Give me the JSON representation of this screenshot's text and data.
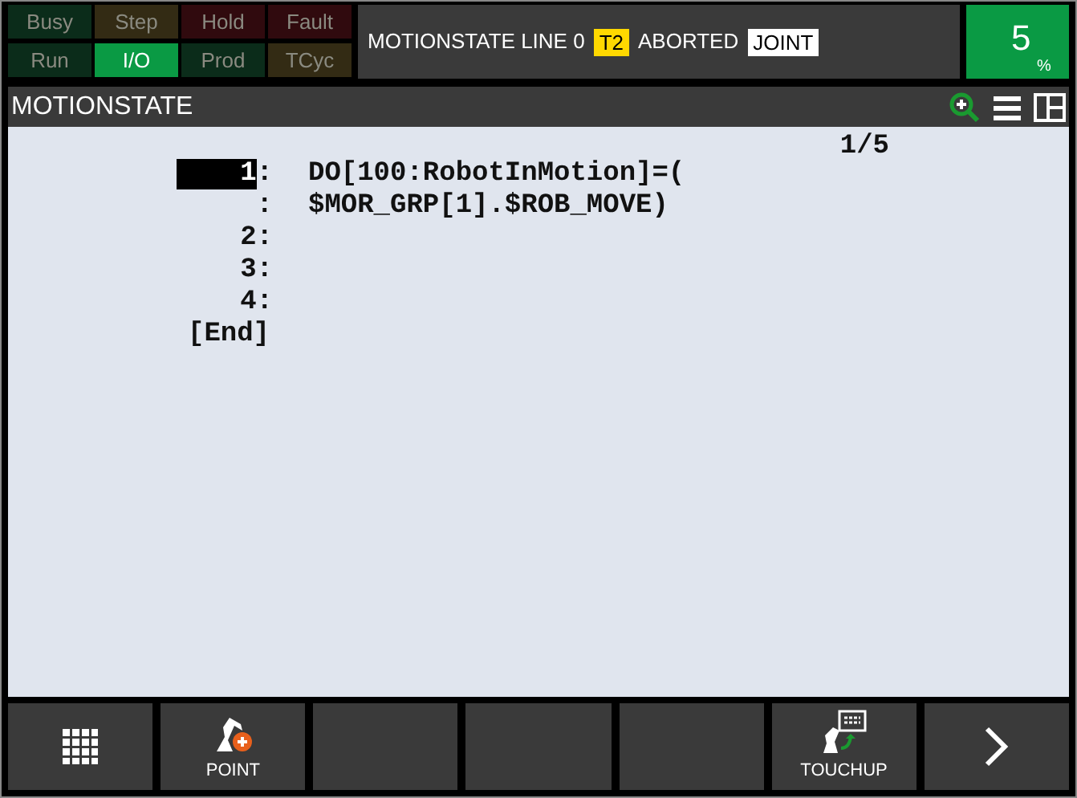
{
  "indicators": [
    {
      "label": "Busy",
      "kind": "green",
      "on": false
    },
    {
      "label": "Step",
      "kind": "yellow",
      "on": false
    },
    {
      "label": "Hold",
      "kind": "red",
      "on": false
    },
    {
      "label": "Fault",
      "kind": "red",
      "on": false
    },
    {
      "label": "Run",
      "kind": "green",
      "on": false
    },
    {
      "label": "I/O",
      "kind": "green",
      "on": true
    },
    {
      "label": "Prod",
      "kind": "green",
      "on": false
    },
    {
      "label": "TCyc",
      "kind": "yellow",
      "on": false
    }
  ],
  "status_line": [
    {
      "kind": "text",
      "text": "MOTIONSTATE LINE 0"
    },
    {
      "kind": "badge",
      "text": "T2",
      "color": "#ffd800"
    },
    {
      "kind": "text",
      "text": "ABORTED"
    },
    {
      "kind": "badge",
      "text": "JOINT",
      "color": "#ffffff"
    }
  ],
  "override": {
    "value": "5",
    "unit": "%"
  },
  "title": "MOTIONSTATE",
  "position": "1/5",
  "program_lines": [
    {
      "number": "1",
      "colon": ":",
      "text": "DO[100:RobotInMotion]=(",
      "selected": true
    },
    {
      "colon": ":",
      "text": "$MOR_GRP[1].$ROB_MOVE)",
      "selected": false
    },
    {
      "number": "2",
      "colon": ":",
      "selected": false
    },
    {
      "number": "3",
      "colon": ":",
      "selected": false
    },
    {
      "number": "4",
      "colon": ":",
      "selected": false
    }
  ],
  "end_marker": "[End]",
  "softkeys": [
    {
      "kind": "menu"
    },
    {
      "kind": "point",
      "label": "POINT"
    },
    {
      "kind": "empty"
    },
    {
      "kind": "empty"
    },
    {
      "kind": "empty"
    },
    {
      "kind": "touchup",
      "label": "TOUCHUP"
    },
    {
      "kind": "next"
    }
  ]
}
